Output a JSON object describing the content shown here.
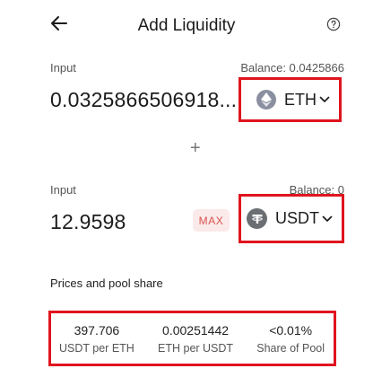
{
  "header": {
    "title": "Add Liquidity"
  },
  "input_a": {
    "label": "Input",
    "balance": "Balance: 0.0425866",
    "amount": "0.0325866506918...",
    "token": "ETH",
    "token_icon": "ethereum-icon"
  },
  "input_b": {
    "label": "Input",
    "balance": "Balance: 0",
    "amount": "12.9598",
    "max_label": "MAX",
    "token": "USDT",
    "token_icon": "tether-icon"
  },
  "plus_sign": "+",
  "prices": {
    "title": "Prices and pool share",
    "items": [
      {
        "value": "397.706",
        "label": "USDT per ETH"
      },
      {
        "value": "0.00251442",
        "label": "ETH per USDT"
      },
      {
        "value": "<0.01%",
        "label": "Share of Pool"
      }
    ]
  },
  "colors": {
    "highlight": "#e0141e",
    "max_text": "#d8544f",
    "max_bg": "#fbeaea"
  }
}
